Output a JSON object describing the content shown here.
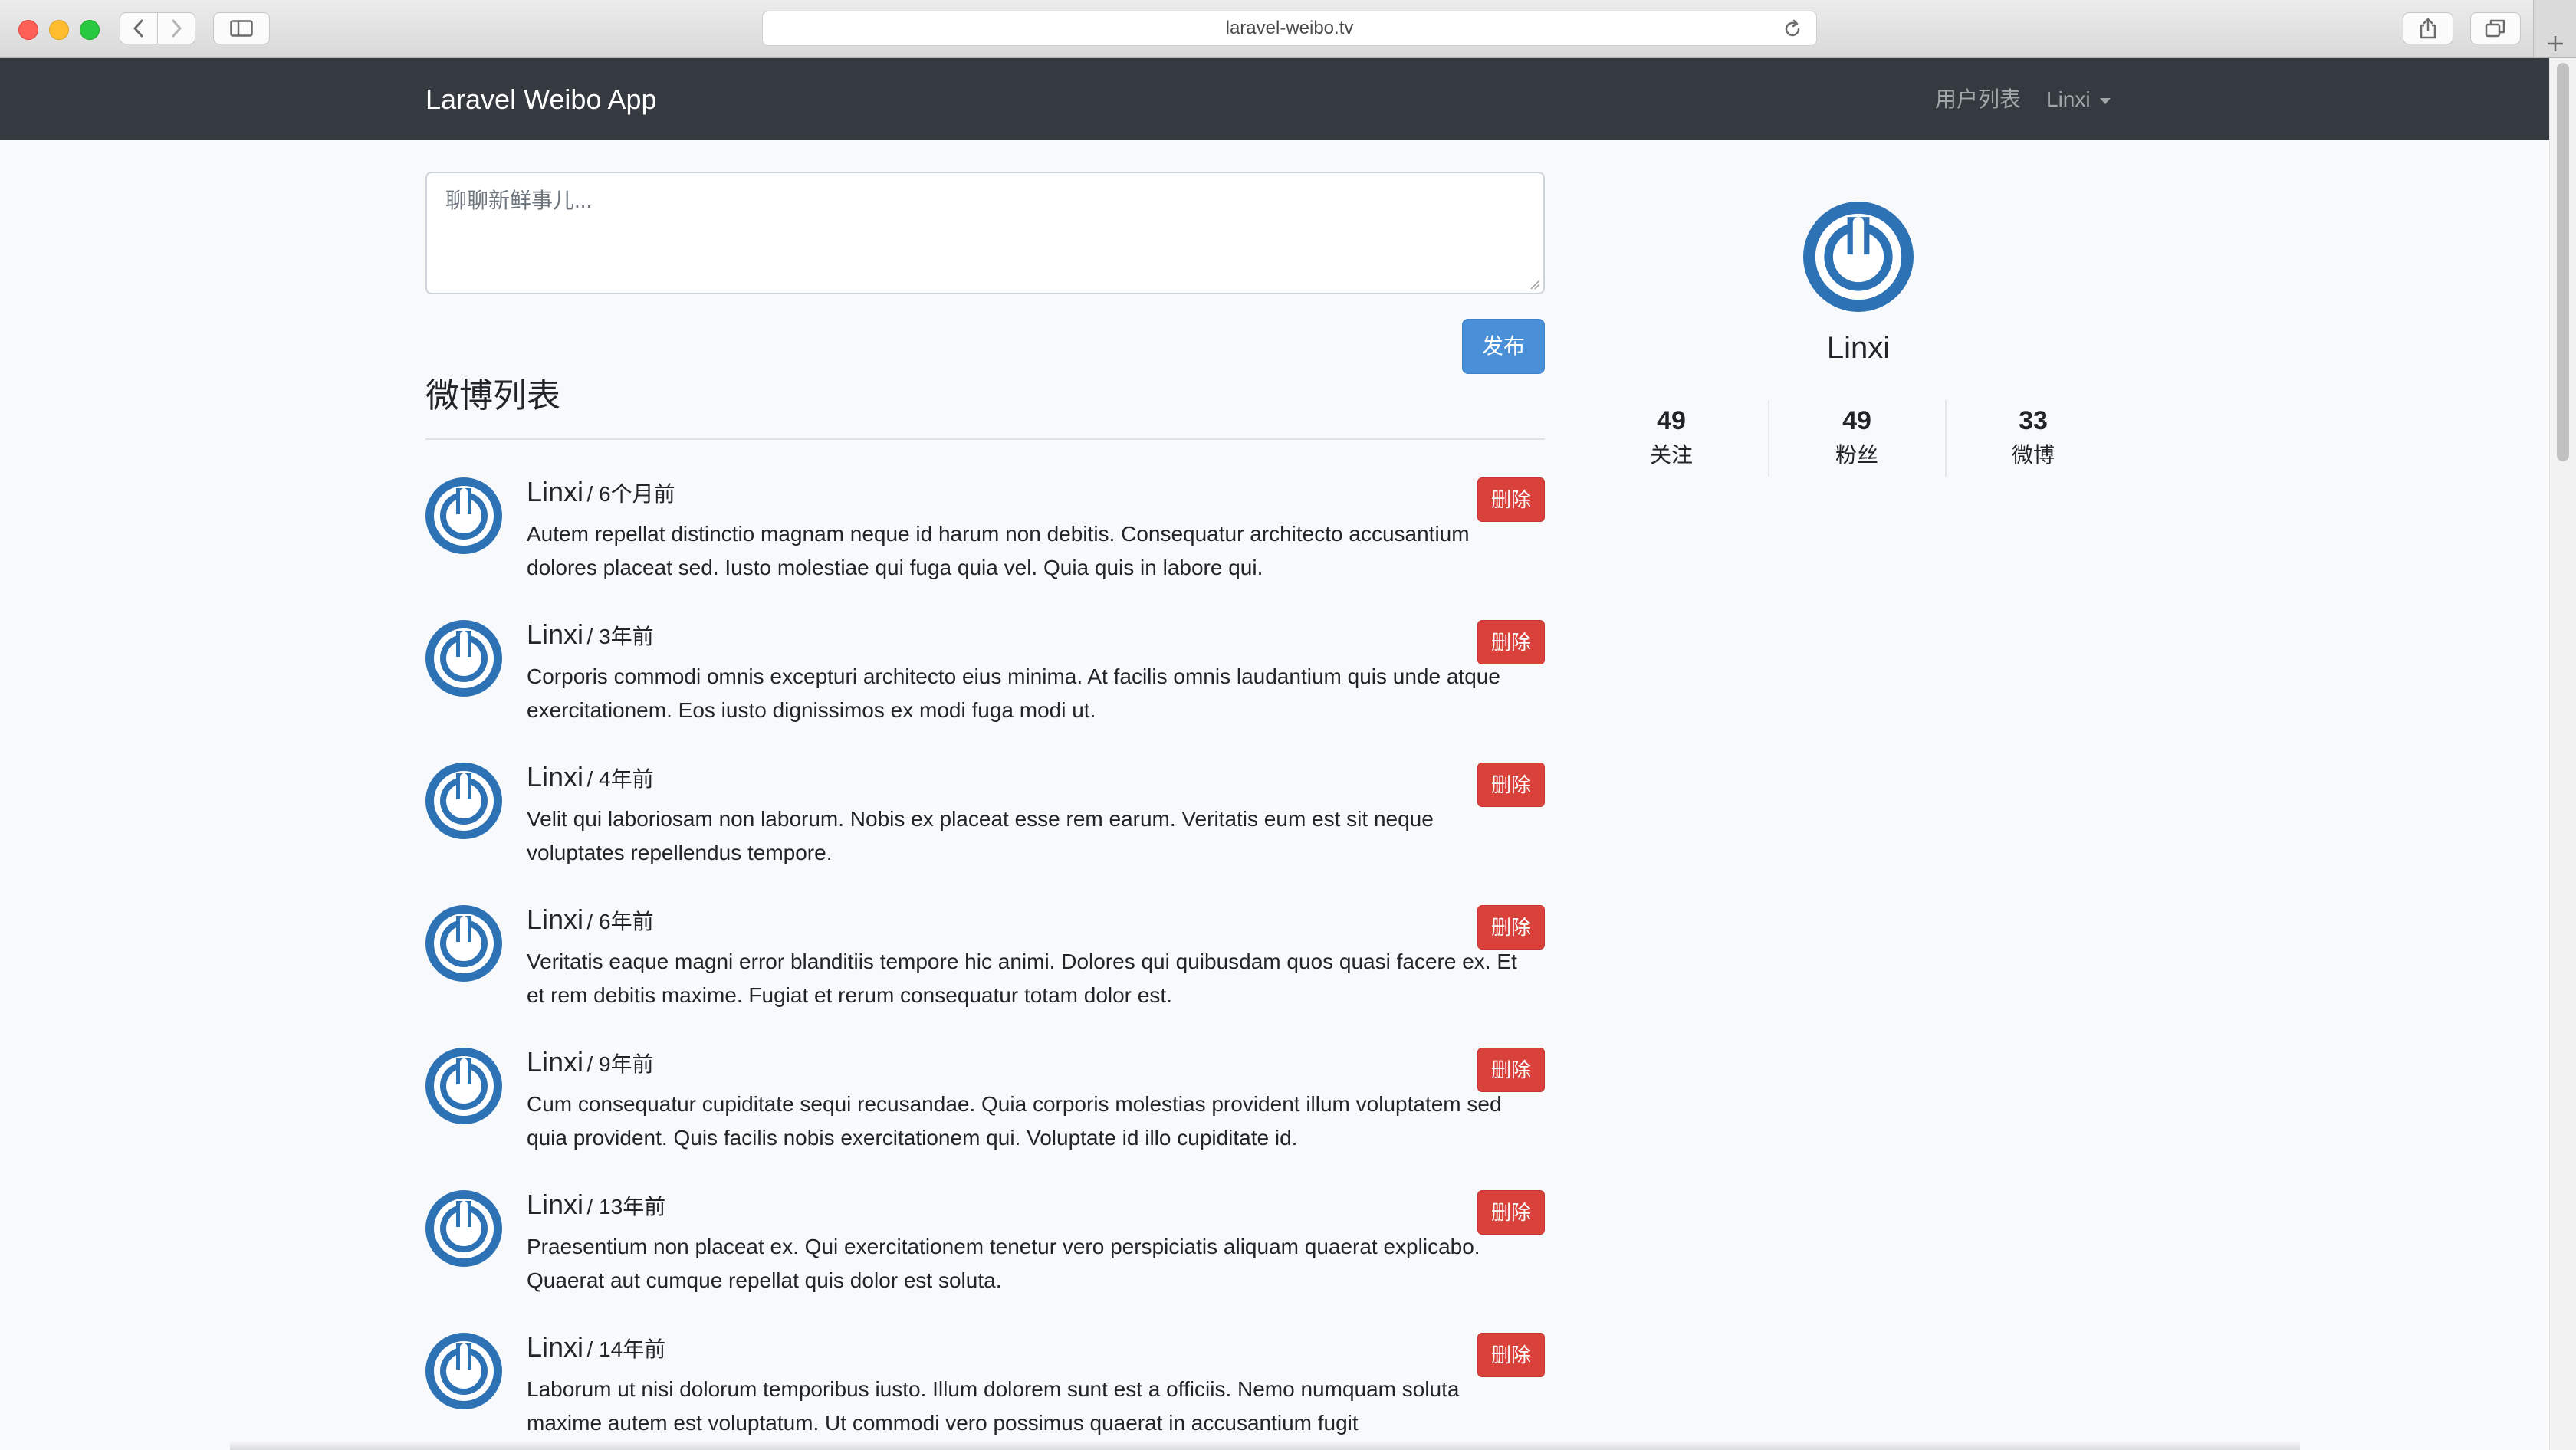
{
  "browser": {
    "url": "laravel-weibo.tv"
  },
  "navbar": {
    "brand": "Laravel Weibo App",
    "users_link": "用户列表",
    "user_menu": "Linxi"
  },
  "composer": {
    "placeholder": "聊聊新鲜事儿...",
    "submit_label": "发布"
  },
  "feed": {
    "title": "微博列表",
    "delete_label": "删除",
    "statuses": [
      {
        "user": "Linxi",
        "time": "/ 6个月前",
        "content": "Autem repellat distinctio magnam neque id harum non debitis. Consequatur architecto accusantium dolores placeat sed. Iusto molestiae qui fuga quia vel. Quia quis in labore qui."
      },
      {
        "user": "Linxi",
        "time": "/ 3年前",
        "content": "Corporis commodi omnis excepturi architecto eius minima. At facilis omnis laudantium quis unde atque exercitationem. Eos iusto dignissimos ex modi fuga modi ut."
      },
      {
        "user": "Linxi",
        "time": "/ 4年前",
        "content": "Velit qui laboriosam non laborum. Nobis ex placeat esse rem earum. Veritatis eum est sit neque voluptates repellendus tempore."
      },
      {
        "user": "Linxi",
        "time": "/ 6年前",
        "content": "Veritatis eaque magni error blanditiis tempore hic animi. Dolores qui quibusdam quos quasi facere ex. Et et rem debitis maxime. Fugiat et rerum consequatur totam dolor est."
      },
      {
        "user": "Linxi",
        "time": "/ 9年前",
        "content": "Cum consequatur cupiditate sequi recusandae. Quia corporis molestias provident illum voluptatem sed quia provident. Quis facilis nobis exercitationem qui. Voluptate id illo cupiditate id."
      },
      {
        "user": "Linxi",
        "time": "/ 13年前",
        "content": "Praesentium non placeat ex. Qui exercitationem tenetur vero perspiciatis aliquam quaerat explicabo. Quaerat aut cumque repellat quis dolor est soluta."
      },
      {
        "user": "Linxi",
        "time": "/ 14年前",
        "content": "Laborum ut nisi dolorum temporibus iusto. Illum dolorem sunt est a officiis. Nemo numquam soluta maxime autem est voluptatum. Ut commodi vero possimus quaerat in accusantium fugit"
      }
    ]
  },
  "profile": {
    "name": "Linxi",
    "stats": [
      {
        "value": "49",
        "label": "关注"
      },
      {
        "value": "49",
        "label": "粉丝"
      },
      {
        "value": "33",
        "label": "微博"
      }
    ]
  }
}
